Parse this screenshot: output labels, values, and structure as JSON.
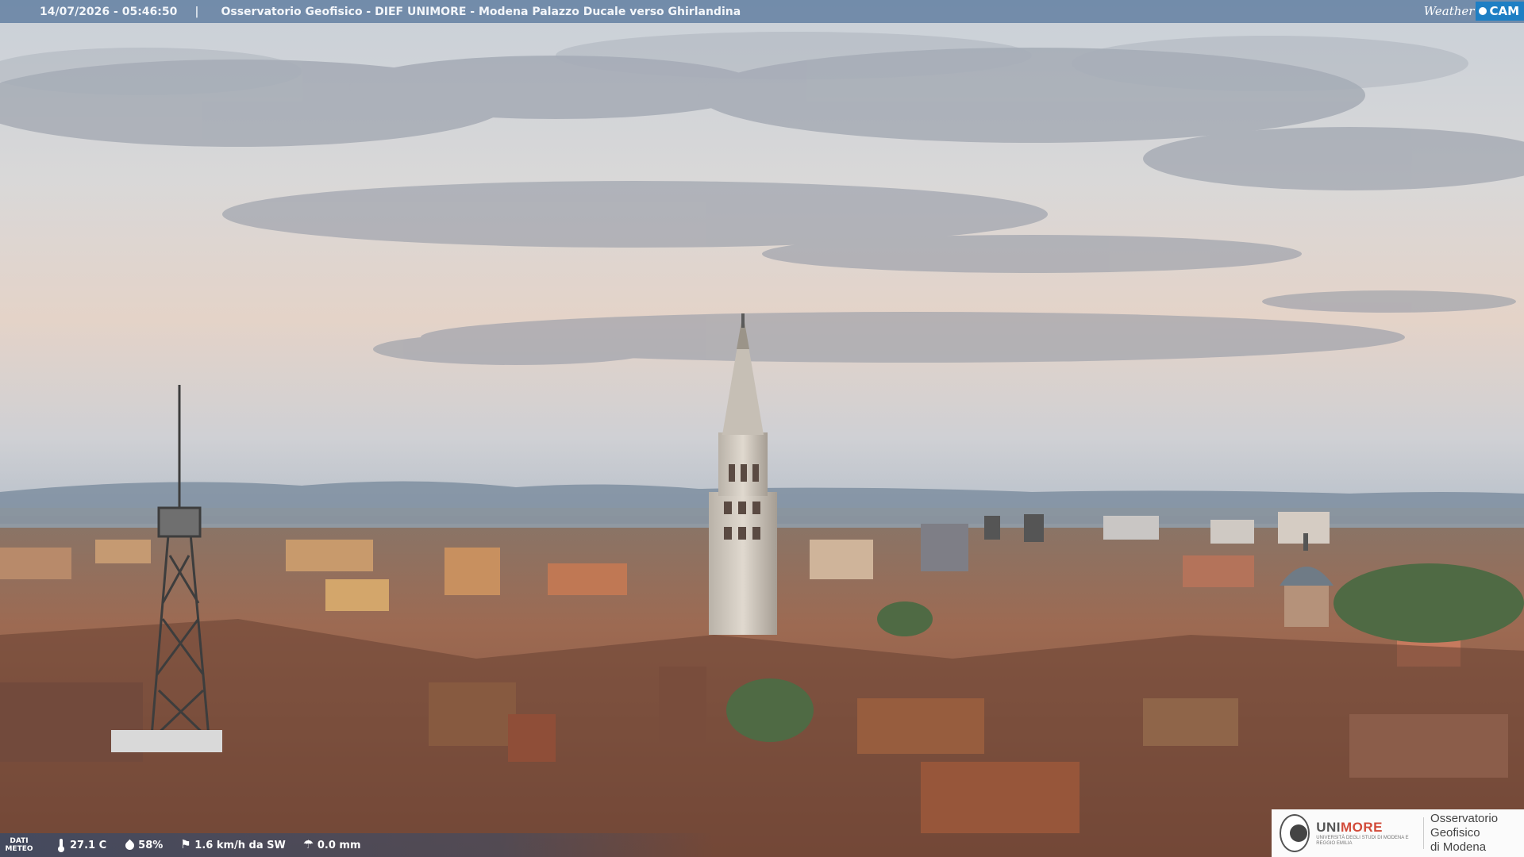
{
  "caption": {
    "datetime": "14/07/2026 - 05:46:50",
    "separator": "|",
    "title": "Osservatorio Geofisico - DIEF UNIMORE - Modena Palazzo Ducale verso Ghirlandina"
  },
  "brand": {
    "weather": "Weather",
    "cam": "CAM"
  },
  "meteo": {
    "label": "DATI METEO",
    "temperature": "27.1 C",
    "humidity": "58%",
    "wind": "1.6 km/h da SW",
    "rain": "0.0 mm"
  },
  "logo": {
    "uni_prefix": "UNI",
    "uni_suffix": "MORE",
    "uni_small": "UNIVERSITÀ DEGLI STUDI DI MODENA E REGGIO EMILIA",
    "observatory_line1": "Osservatorio Geofisico",
    "observatory_line2": "di Modena"
  },
  "colors": {
    "caption_bar": "#5f7da0",
    "brand_accent": "#1e7fc4",
    "roof_terracotta": "#a0583f",
    "sky_top": "#cfd5dc",
    "sky_horizon": "#e6d2c6"
  }
}
